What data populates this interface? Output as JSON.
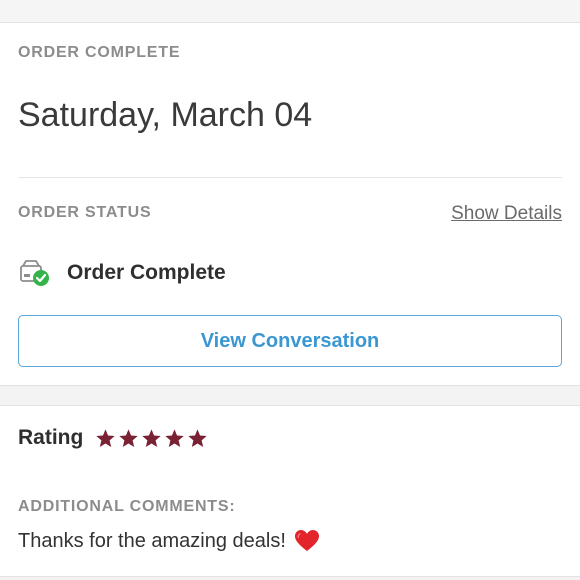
{
  "order": {
    "section_title": "ORDER COMPLETE",
    "date": "Saturday, March 04",
    "status_title": "ORDER STATUS",
    "show_details": "Show Details",
    "status_text": "Order Complete",
    "view_conversation": "View Conversation"
  },
  "rating": {
    "label": "Rating",
    "stars": 5,
    "max_stars": 5,
    "comments_title": "ADDITIONAL COMMENTS:",
    "comment": "Thanks for the amazing deals!"
  },
  "colors": {
    "accent": "#3b97d1",
    "star": "#7a2234",
    "success": "#34b34a",
    "heart": "#e3242b"
  },
  "icons": {
    "status": "package-check-icon",
    "rating": "star-icon",
    "comment": "heart-icon"
  }
}
